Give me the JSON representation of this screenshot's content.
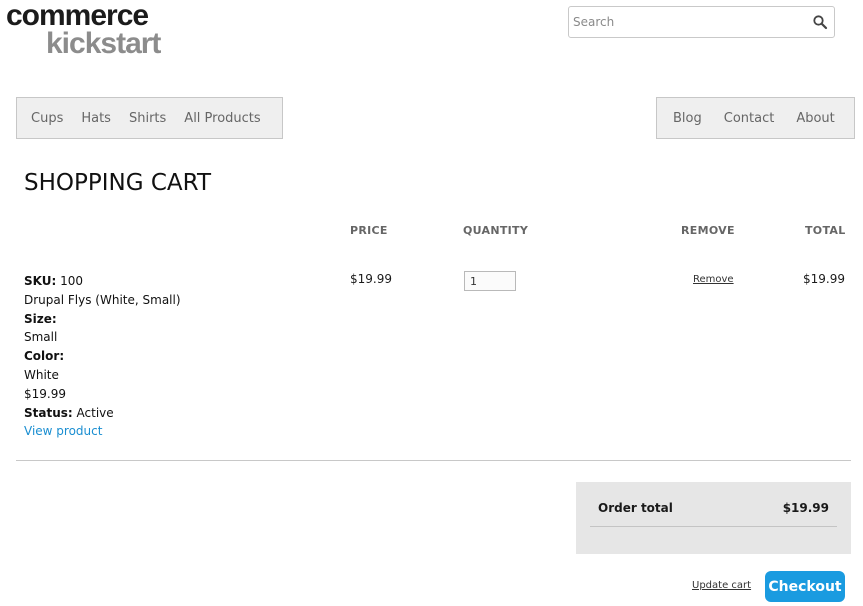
{
  "logo": {
    "line1": "commerce",
    "line2": "kickstart"
  },
  "search": {
    "placeholder": "Search",
    "icon": "search-icon"
  },
  "nav_left": [
    "Cups",
    "Hats",
    "Shirts",
    "All Products"
  ],
  "nav_right": [
    "Blog",
    "Contact",
    "About"
  ],
  "page_title": "SHOPPING CART",
  "columns": {
    "price": "PRICE",
    "quantity": "QUANTITY",
    "remove": "REMOVE",
    "total": "TOTAL"
  },
  "item": {
    "sku_label": "SKU:",
    "sku": "100",
    "name": "Drupal Flys (White, Small)",
    "size_label": "Size:",
    "size": "Small",
    "color_label": "Color:",
    "color": "White",
    "unit_price_line": "$19.99",
    "status_label": "Status:",
    "status": "Active",
    "view_link": "View product",
    "price": "$19.99",
    "quantity": "1",
    "remove_label": "Remove",
    "total": "$19.99"
  },
  "order_total": {
    "label": "Order total",
    "value": "$19.99"
  },
  "actions": {
    "update_cart": "Update cart",
    "checkout": "Checkout"
  },
  "colors": {
    "accent": "#1a9be0",
    "link": "#1a8ed1",
    "nav_bg": "#efefef",
    "summary_bg": "#e6e6e6"
  }
}
